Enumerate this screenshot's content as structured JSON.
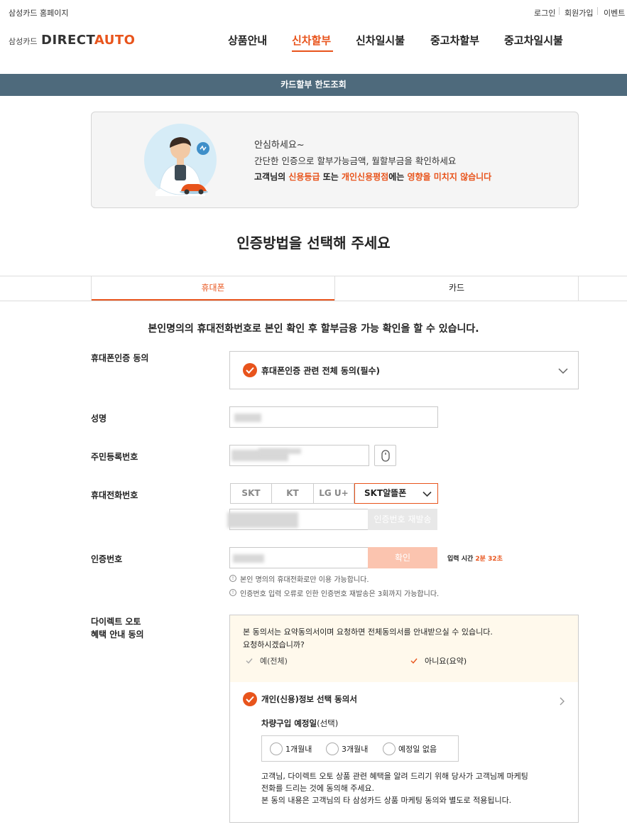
{
  "utility": {
    "homepage": "삼성카드 홈페이지",
    "login": "로그인",
    "signup": "회원가입",
    "event": "이벤트"
  },
  "logo": {
    "company": "삼성카드",
    "brand_a": "DIRECT",
    "brand_b": "AUTO"
  },
  "nav": [
    "상품안내",
    "신차할부",
    "신차일시불",
    "중고차할부",
    "중고차일시불"
  ],
  "banner_title": "카드할부 한도조회",
  "notice": {
    "line1": "안심하세요~",
    "line2": "간단한 인증으로 할부가능금액, 월할부금을 확인하세요",
    "line3_a": "고객님의 ",
    "line3_b": "신용등급",
    "line3_c": " 또는 ",
    "line3_d": "개인신용평점",
    "line3_e": "에는 ",
    "line3_f": "영향을 미치지 않습니다"
  },
  "heading": "인증방법을 선택해 주세요",
  "tabs": [
    "휴대폰",
    "카드"
  ],
  "intro": "본인명의의 휴대전화번호로 본인 확인 후 할부금융 가능 확인을 할 수 있습니다.",
  "form": {
    "agree_label": "휴대폰인증 동의",
    "agree_text": "휴대폰인증 관련 전체 동의(필수)",
    "name_label": "성명",
    "rrn_label": "주민등록번호",
    "phone_label": "휴대전화번호",
    "carriers": [
      "SKT",
      "KT",
      "LG U+"
    ],
    "carrier_selected": "SKT알뜰폰",
    "resend_btn": "인증번호 재발송",
    "code_label": "인증번호",
    "confirm_btn": "확인",
    "timer_label": "입력 시간",
    "timer_value": "2분 32초",
    "note1": "본인 명의의 휴대전화로만 이용 가능합니다.",
    "note2": "인증번호 입력 오류로 인한 인증번호 재발송은 3회까지 가능합니다."
  },
  "benefit": {
    "label_line1": "다이렉트 오토",
    "label_line2": "혜택 안내 동의",
    "summary_line1": "본 동의서는 요약동의서이며 요청하면 전체동의서를 안내받으실 수 있습니다.",
    "summary_line2": "요청하시겠습니까?",
    "opt_full": "예(전체)",
    "opt_summary": "아니요(요약)",
    "consent_title": "개인(신용)정보 선택 동의서",
    "purchase_label": "차량구입 예정일",
    "purchase_optional": "(선택)",
    "purchase_options": [
      "1개월내",
      "3개월내",
      "예정일 없음"
    ],
    "desc1": "고객님, 다이렉트 오토 상품 관련 혜택을 알려 드리기 위해 당사가 고객님께 마케팅",
    "desc2": "전화를 드리는 것에 동의해 주세요.",
    "desc3": "본 동의 내용은 고객님의 타 삼성카드 상품 마케팅 동의와 별도로 적용됩니다."
  },
  "colors": {
    "accent": "#e8541c",
    "banner": "#4e6a7c"
  }
}
